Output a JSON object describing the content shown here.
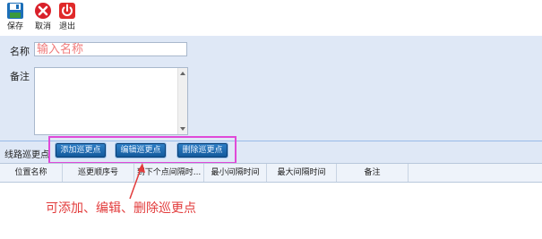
{
  "toolbar": {
    "save_label": "保存",
    "cancel_label": "取消",
    "exit_label": "退出"
  },
  "form": {
    "name_label": "名称",
    "name_value": "输入名称",
    "remark_label": "备注",
    "remark_value": ""
  },
  "points_bar": {
    "label": "线路巡更点",
    "add_label": "添加巡更点",
    "edit_label": "编辑巡更点",
    "delete_label": "删除巡更点"
  },
  "grid": {
    "columns": [
      "位置名称",
      "巡更顺序号",
      "到下个点间隔时...",
      "最小间隔时间",
      "最大间隔时间",
      "备注"
    ]
  },
  "annotation": {
    "text": "可添加、编辑、删除巡更点",
    "color": "#e23b3b",
    "frame_color": "#e04ad8"
  },
  "icons": [
    "floppy-save-icon",
    "red-x-cancel-icon",
    "power-exit-icon"
  ]
}
